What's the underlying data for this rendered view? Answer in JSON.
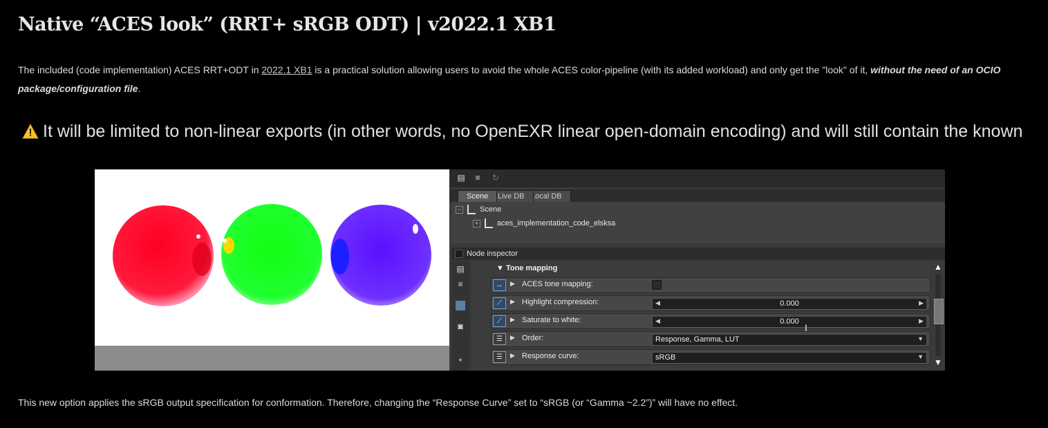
{
  "article": {
    "title": "Native “ACES look” (RRT+ sRGB ODT) | v2022.1 XB1",
    "intro_before_link": "The included (code implementation) ACES RRT+ODT in ",
    "intro_link": "2022.1 XB1",
    "intro_after_link": " is a practical solution allowing users to avoid the whole ACES color-pipeline (with its added workload) and only get the \"look\" of it, ",
    "intro_bold": "without the need of an OCIO package/configuration file",
    "intro_end": ".",
    "warning_text": "It will be limited to non-linear exports (in other words, no OpenEXR linear open-domain encoding) and will still contain the known",
    "bottom_text": "This new option applies the sRGB output specification for conformation. Therefore, changing the  “Response Curve” set to “sRGB (or “Gamma ~2.2”)” will have no effect."
  },
  "colors": {
    "sphere_red": "#ff1030",
    "sphere_green": "#10ff10",
    "sphere_blue": "#5a20ff"
  },
  "panel": {
    "tabs": [
      "Scene",
      "Live DB",
      "Local DB"
    ],
    "tree": {
      "root": "Scene",
      "child": "aces_implementation_code_elsksa"
    },
    "inspector_title": "Node inspector",
    "section_title": "▼ Tone mapping",
    "rows": {
      "aces_label": "ACES tone mapping:",
      "highlight_label": "Highlight compression:",
      "highlight_value": "0.000",
      "saturate_label": "Saturate to white:",
      "saturate_value": "0.000",
      "order_label": "Order:",
      "order_value": "Response, Gamma, LUT",
      "response_label": "Response curve:",
      "response_value": "sRGB"
    }
  }
}
